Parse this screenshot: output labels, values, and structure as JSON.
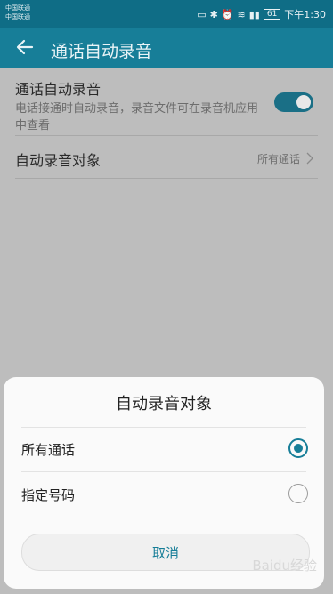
{
  "status_bar": {
    "carrier_1": "中国联通",
    "carrier_2": "中国联通",
    "time": "下午1:30",
    "battery": "61"
  },
  "app_bar": {
    "title": "通话自动录音"
  },
  "settings": {
    "auto_record": {
      "title": "通话自动录音",
      "description": "电话接通时自动录音，录音文件可在录音机应用中查看",
      "enabled": true
    },
    "record_target": {
      "title": "自动录音对象",
      "value": "所有通话"
    }
  },
  "dialog": {
    "title": "自动录音对象",
    "options": [
      {
        "label": "所有通话",
        "selected": true
      },
      {
        "label": "指定号码",
        "selected": false
      }
    ],
    "cancel_label": "取消"
  },
  "watermark": "Baidu经验",
  "colors": {
    "accent": "#177e98",
    "status_bar": "#0f6d86",
    "scrim": "#bdbdbd"
  }
}
